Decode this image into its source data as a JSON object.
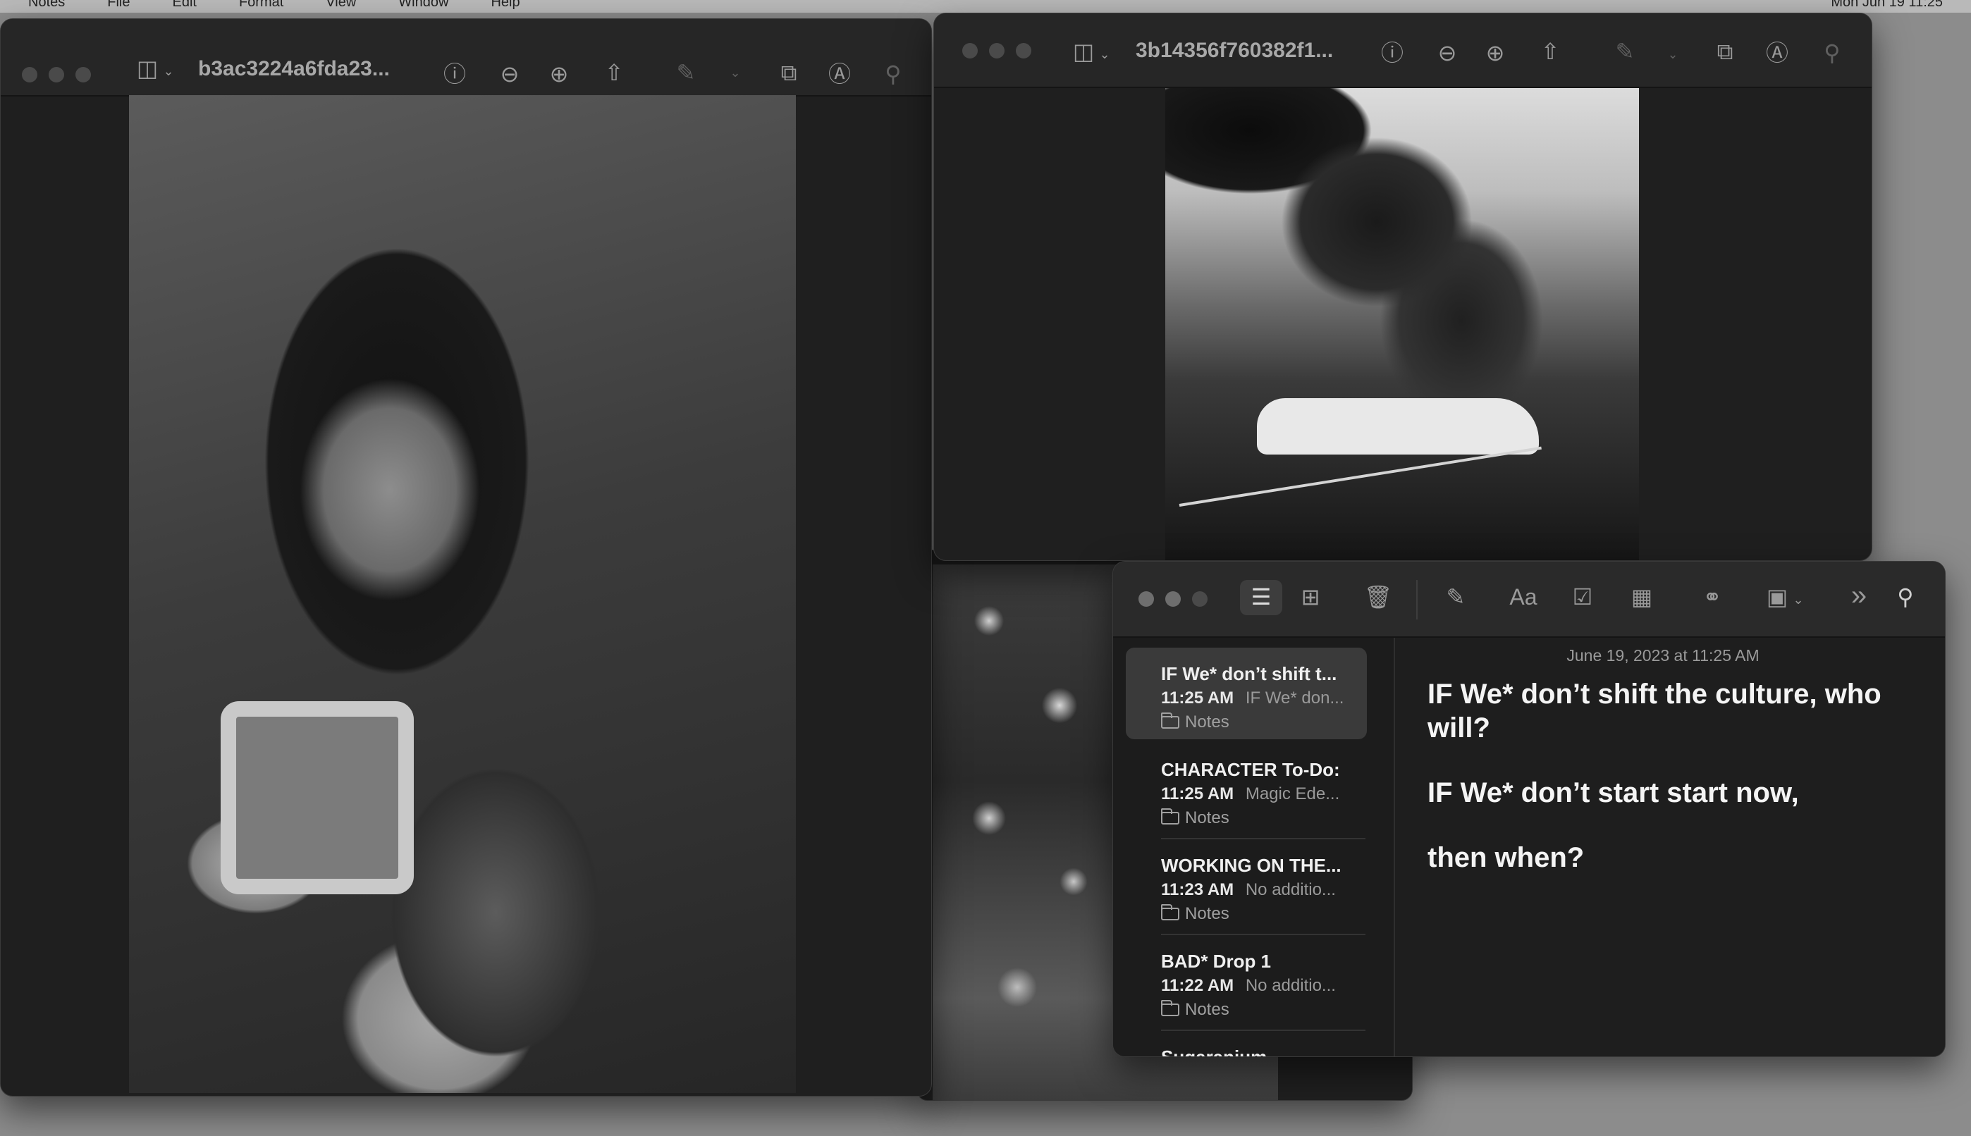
{
  "menubar": {
    "items": [
      "Notes",
      "File",
      "Edit",
      "Format",
      "View",
      "Window",
      "Help"
    ],
    "clock": "Mon Jun 19  11:25"
  },
  "preview_left": {
    "title": "b3ac3224a6fda23..."
  },
  "preview_right": {
    "title": "3b14356f760382f1..."
  },
  "notes": {
    "date": "June 19, 2023 at 11:25 AM",
    "body": {
      "line1": "IF We* don’t shift the culture, who will?",
      "line2": "IF We* don’t start start now,",
      "line3": "then when?"
    },
    "list": [
      {
        "title": "IF We* don’t shift t...",
        "time": "11:25 AM",
        "preview": "IF We* don...",
        "folder": "Notes"
      },
      {
        "title": "CHARACTER To-Do:",
        "time": "11:25 AM",
        "preview": "Magic Ede...",
        "folder": "Notes"
      },
      {
        "title": "WORKING ON THE...",
        "time": "11:23 AM",
        "preview": "No additio...",
        "folder": "Notes"
      },
      {
        "title": "BAD* Drop 1",
        "time": "11:22 AM",
        "preview": "No additio...",
        "folder": "Notes"
      },
      {
        "title": "Sugaranium",
        "time": "",
        "preview": "",
        "folder": ""
      }
    ],
    "toolbar": {
      "format_label": "Aa",
      "more_label": "»"
    }
  },
  "icons": {
    "sidebar": "sidebar-toggle-icon",
    "info": "info-icon",
    "zoom_out": "zoom-out-icon",
    "zoom_in": "zoom-in-icon",
    "share": "share-icon",
    "markup": "markup-pen-icon",
    "rotate": "rotate-icon",
    "annotate": "annotate-icon",
    "search": "search-icon"
  },
  "colors": {
    "window_bg": "#1f1f1f",
    "titlebar": "#262626",
    "selection": "#3a3a3a",
    "desktop": "#8c8c8c"
  }
}
